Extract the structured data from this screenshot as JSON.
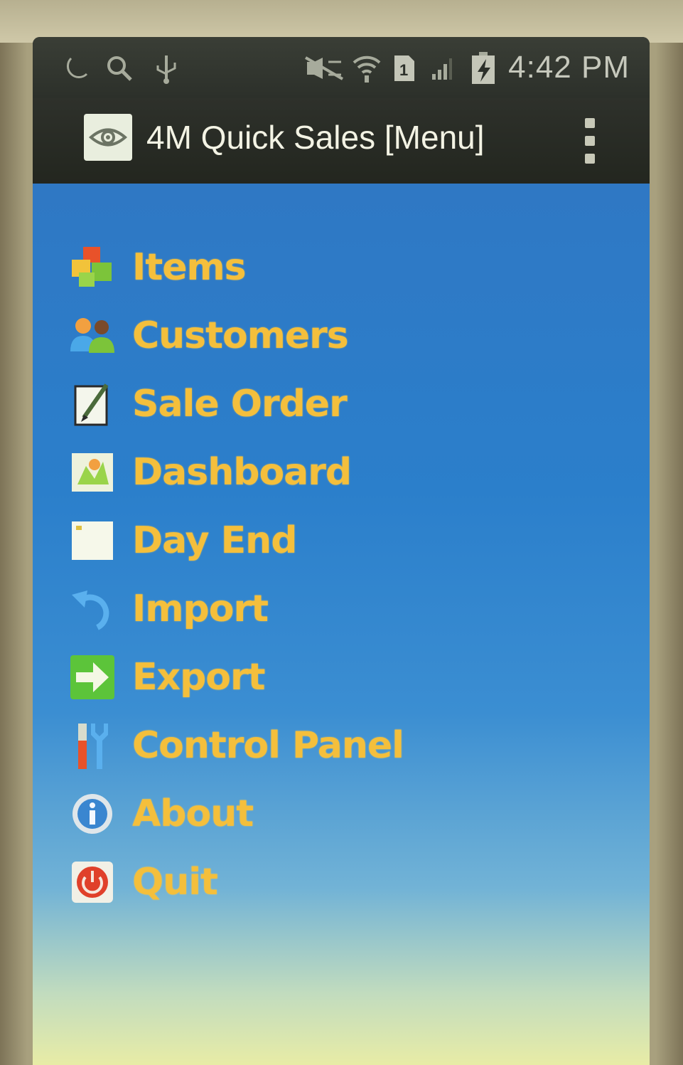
{
  "status_bar": {
    "time": "4:42 PM",
    "icons": [
      "moon-icon",
      "search-icon",
      "usb-icon",
      "mute-icon",
      "wifi-icon",
      "sim-icon",
      "signal-icon",
      "battery-charging-icon"
    ]
  },
  "action_bar": {
    "title": "4M Quick Sales [Menu]",
    "logo_icon": "eye-logo-icon",
    "overflow_icon": "overflow-menu-icon"
  },
  "menu": {
    "items": [
      {
        "label": "Items",
        "icon": "items-icon"
      },
      {
        "label": "Customers",
        "icon": "customers-icon"
      },
      {
        "label": "Sale Order",
        "icon": "sale-order-icon"
      },
      {
        "label": "Dashboard",
        "icon": "dashboard-icon"
      },
      {
        "label": "Day End",
        "icon": "day-end-icon"
      },
      {
        "label": "Import",
        "icon": "import-icon"
      },
      {
        "label": "Export",
        "icon": "export-icon"
      },
      {
        "label": "Control Panel",
        "icon": "control-panel-icon"
      },
      {
        "label": "About",
        "icon": "about-icon"
      },
      {
        "label": "Quit",
        "icon": "quit-icon"
      }
    ]
  },
  "colors": {
    "menu_text": "#f4bf3c",
    "background_top": "#2f78c4",
    "background_bottom": "#e8eca6",
    "action_bar": "#2e312b"
  }
}
